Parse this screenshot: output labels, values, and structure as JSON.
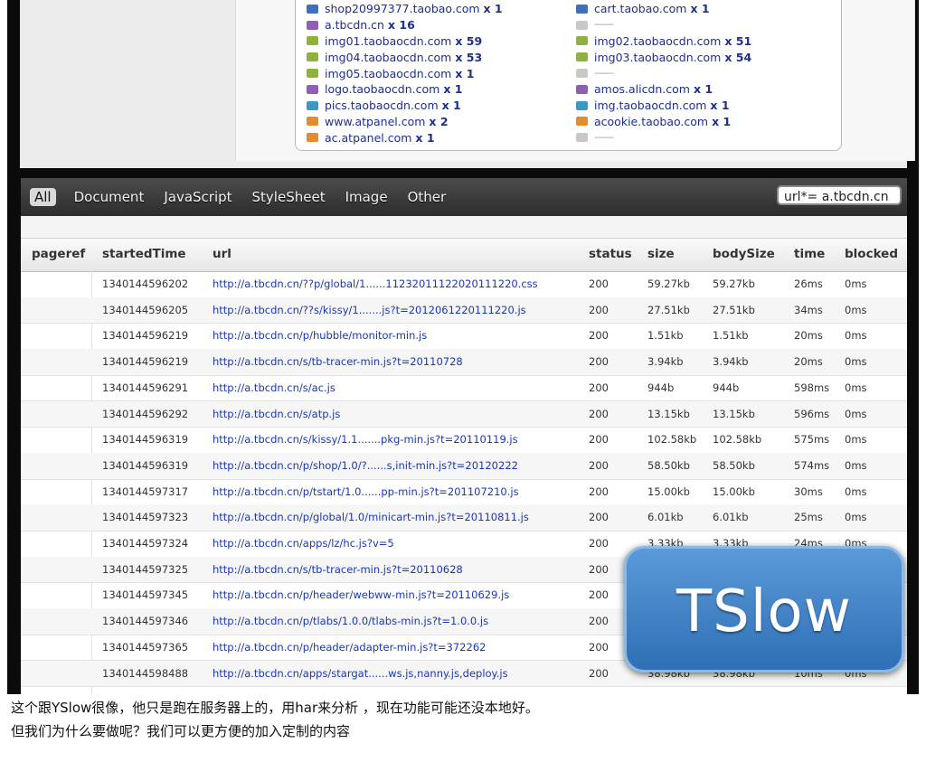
{
  "domains_left": [
    {
      "name": "shop20997377.taobao.com",
      "count": "1",
      "color": "#3f6fbf"
    },
    {
      "name": "a.tbcdn.cn",
      "count": "16",
      "color": "#8e5fb4"
    },
    {
      "name": "img01.taobaocdn.com",
      "count": "59",
      "color": "#8db33c"
    },
    {
      "name": "img04.taobaocdn.com",
      "count": "53",
      "color": "#8db33c"
    },
    {
      "name": "img05.taobaocdn.com",
      "count": "1",
      "color": "#8db33c"
    },
    {
      "name": "logo.taobaocdn.com",
      "count": "1",
      "color": "#8e5fb4"
    },
    {
      "name": "pics.taobaocdn.com",
      "count": "1",
      "color": "#3b98c4"
    },
    {
      "name": "www.atpanel.com",
      "count": "2",
      "color": "#e58b2e"
    },
    {
      "name": "ac.atpanel.com",
      "count": "1",
      "color": "#e58b2e"
    }
  ],
  "domains_right": [
    {
      "name": "cart.taobao.com",
      "count": "1",
      "color": "#3f6fbf"
    },
    {
      "name": "",
      "count": "",
      "color": "#c8c8c8"
    },
    {
      "name": "img02.taobaocdn.com",
      "count": "51",
      "color": "#8db33c"
    },
    {
      "name": "img03.taobaocdn.com",
      "count": "54",
      "color": "#8db33c"
    },
    {
      "name": "",
      "count": "",
      "color": "#c8c8c8"
    },
    {
      "name": "amos.alicdn.com",
      "count": "1",
      "color": "#8e5fb4"
    },
    {
      "name": "img.taobaocdn.com",
      "count": "1",
      "color": "#3b98c4"
    },
    {
      "name": "acookie.taobao.com",
      "count": "1",
      "color": "#e58b2e"
    },
    {
      "name": "",
      "count": "",
      "color": "#c8c8c8"
    }
  ],
  "count_prefix": "x",
  "toolbar": {
    "filters": [
      "All",
      "Document",
      "JavaScript",
      "StyleSheet",
      "Image",
      "Other"
    ],
    "active_filter": "All",
    "filter_value": "url*= a.tbcdn.cn"
  },
  "table": {
    "headers": [
      "pageref",
      "startedTime",
      "url",
      "status",
      "size",
      "bodySize",
      "time",
      "blocked"
    ],
    "rows": [
      [
        "",
        "1340144596202",
        "http://a.tbcdn.cn/??p/global/1......1123201112202011​1220.css",
        "200",
        "59.27kb",
        "59.27kb",
        "26ms",
        "0ms"
      ],
      [
        "",
        "1340144596205",
        "http://a.tbcdn.cn/??s/kissy/1.......js?t=2012061220111220.js",
        "200",
        "27.51kb",
        "27.51kb",
        "34ms",
        "0ms"
      ],
      [
        "",
        "1340144596219",
        "http://a.tbcdn.cn/p/hubble/monitor-min.js",
        "200",
        "1.51kb",
        "1.51kb",
        "20ms",
        "0ms"
      ],
      [
        "",
        "1340144596219",
        "http://a.tbcdn.cn/s/tb-tracer-min.js?t=20110728",
        "200",
        "3.94kb",
        "3.94kb",
        "20ms",
        "0ms"
      ],
      [
        "",
        "1340144596291",
        "http://a.tbcdn.cn/s/ac.js",
        "200",
        "944b",
        "944b",
        "598ms",
        "0ms"
      ],
      [
        "",
        "1340144596292",
        "http://a.tbcdn.cn/s/atp.js",
        "200",
        "13.15kb",
        "13.15kb",
        "596ms",
        "0ms"
      ],
      [
        "",
        "1340144596319",
        "http://a.tbcdn.cn/s/kissy/1.1.......pkg-min.js?t=20110119.js",
        "200",
        "102.58kb",
        "102.58kb",
        "575ms",
        "0ms"
      ],
      [
        "",
        "1340144596319",
        "http://a.tbcdn.cn/p/shop/1.0/?......s,init-min.js?t=20120222",
        "200",
        "58.50kb",
        "58.50kb",
        "574ms",
        "0ms"
      ],
      [
        "",
        "1340144597317",
        "http://a.tbcdn.cn/p/tstart/1.0......pp-min.js?t=201107210.js",
        "200",
        "15.00kb",
        "15.00kb",
        "30ms",
        "0ms"
      ],
      [
        "",
        "1340144597323",
        "http://a.tbcdn.cn/p/global/1.0/minicart-min.js?t=20110811.js",
        "200",
        "6.01kb",
        "6.01kb",
        "25ms",
        "0ms"
      ],
      [
        "",
        "1340144597324",
        "http://a.tbcdn.cn/apps/lz/hc.js?v=5",
        "200",
        "3.33kb",
        "3.33kb",
        "24ms",
        "0ms"
      ],
      [
        "",
        "1340144597325",
        "http://a.tbcdn.cn/s/tb-tracer-min.js?t=20110628",
        "200",
        "",
        "",
        "",
        ""
      ],
      [
        "",
        "1340144597345",
        "http://a.tbcdn.cn/p/header/webww-min.js?t=20110629.js",
        "200",
        "",
        "",
        "",
        ""
      ],
      [
        "",
        "1340144597346",
        "http://a.tbcdn.cn/p/tlabs/1.0.0/tlabs-min.js?t=1.0.0.js",
        "200",
        "",
        "",
        "",
        ""
      ],
      [
        "",
        "1340144597365",
        "http://a.tbcdn.cn/p/header/adapter-min.js?t=372262",
        "200",
        "",
        "",
        "",
        ""
      ],
      [
        "",
        "1340144598488",
        "http://a.tbcdn.cn/apps/stargat......ws.js,nanny.js,deploy.js",
        "200",
        "38.98kb",
        "38.98kb",
        "10ms",
        "0ms"
      ]
    ]
  },
  "badge": "TSlow",
  "caption": {
    "line1": "这个跟YSlow很像，他只是跑在服务器上的，用har来分析 ，现在功能可能还没本地好。",
    "line2": "但我们为什么要做呢？我们可以更方便的加入定制的内容"
  }
}
